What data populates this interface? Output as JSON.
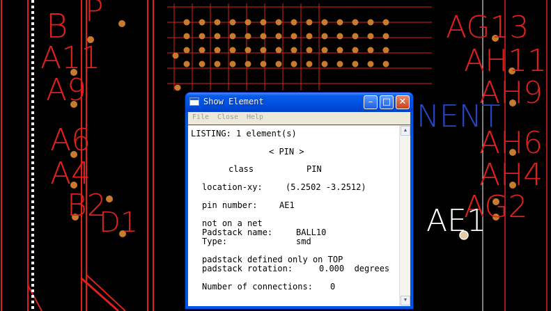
{
  "window": {
    "title": "Show Element",
    "minimize_glyph": "–",
    "maximize_glyph": "□",
    "close_glyph": "✕"
  },
  "menu": [
    "File",
    "Close",
    "Help"
  ],
  "listing": {
    "header": "LISTING: 1 element(s)",
    "section": "< PIN >",
    "class_label": "class",
    "class_value": "PIN",
    "location_label": "location-xy:",
    "location_value": "(5.2502 -3.2512)",
    "pin_number_label": "pin number:",
    "pin_number_value": "AE1",
    "net_status": "not on a net",
    "padstack_name_label": "Padstack name:",
    "padstack_name_value": "BALL10",
    "type_label": "Type:",
    "type_value": "smd",
    "padstack_defined": "padstack defined only on TOP",
    "padstack_rotation_label": "padstack rotation:",
    "padstack_rotation_value": "0.000  degrees",
    "connections_label": "Number of connections:",
    "connections_value": "0"
  },
  "cad_labels": [
    {
      "text": "B",
      "color": "red"
    },
    {
      "text": "P",
      "color": "red"
    },
    {
      "text": "A11",
      "color": "red"
    },
    {
      "text": "A9",
      "color": "red"
    },
    {
      "text": "A6",
      "color": "red"
    },
    {
      "text": "A4",
      "color": "red"
    },
    {
      "text": "B2",
      "color": "red"
    },
    {
      "text": "D1",
      "color": "red"
    },
    {
      "text": "AG13",
      "color": "red"
    },
    {
      "text": "AH11",
      "color": "red"
    },
    {
      "text": "AH9",
      "color": "red"
    },
    {
      "text": "AH6",
      "color": "red"
    },
    {
      "text": "AH4",
      "color": "red"
    },
    {
      "text": "AG2",
      "color": "red"
    },
    {
      "text": "AE1",
      "color": "white"
    },
    {
      "text": "NENT",
      "color": "blue"
    }
  ],
  "colors": {
    "trace": "#e0201c",
    "pad": "#c87a2e",
    "background": "#000000"
  }
}
